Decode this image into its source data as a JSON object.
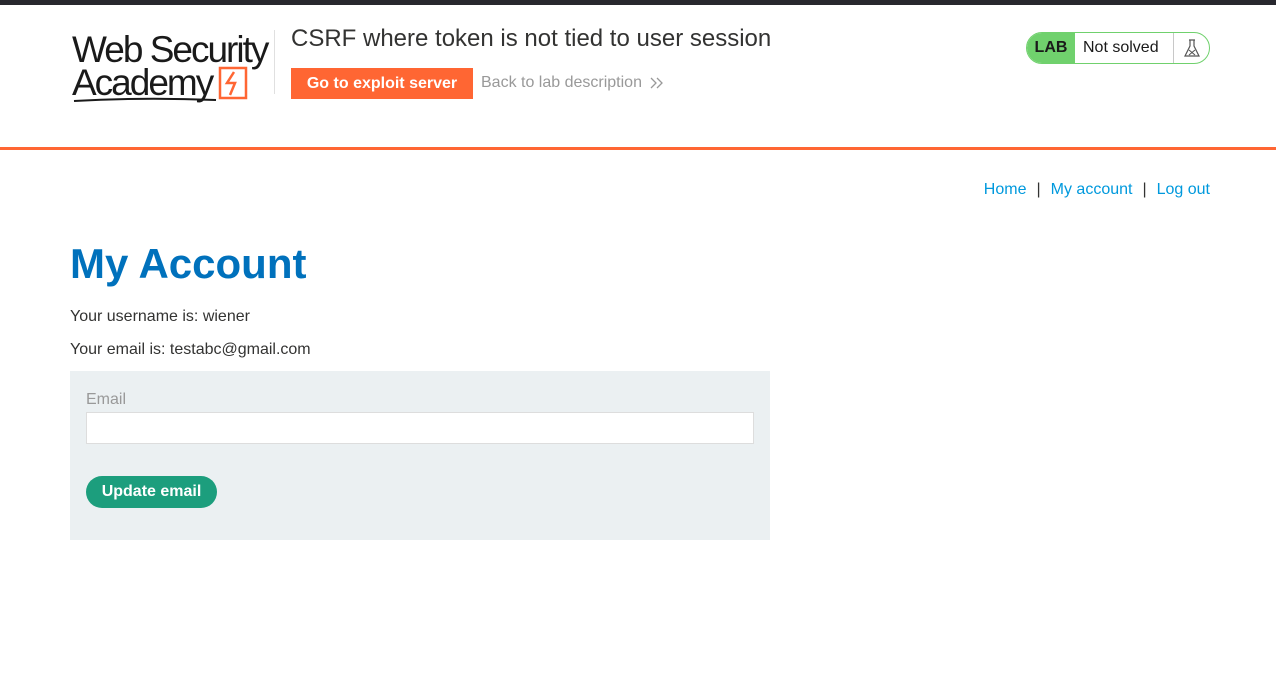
{
  "header": {
    "logo_line1": "Web Security",
    "logo_line2": "Academy",
    "lab_title": "CSRF where token is not tied to user session",
    "exploit_button": "Go to exploit server",
    "back_link": "Back to lab description",
    "status_badge": "LAB",
    "status_text": "Not solved"
  },
  "nav": {
    "home": "Home",
    "separator": "|",
    "my_account": "My account",
    "log_out": "Log out"
  },
  "main": {
    "title": "My Account",
    "username_text": "Your username is: wiener",
    "email_text": "Your email is: testabc@gmail.com",
    "form": {
      "email_label": "Email",
      "email_value": "",
      "submit_label": "Update email"
    }
  },
  "colors": {
    "accent_orange": "#ff6633",
    "title_blue": "#0071bc",
    "link_blue": "#0099dd",
    "status_green": "#70d16d",
    "button_green": "#1c9e7d",
    "panel_bg": "#ebf0f2"
  },
  "icons": {
    "logo_mark": "lightning-bolt-icon",
    "back_chevron": "double-chevron-right-icon",
    "lab_status": "flask-icon"
  }
}
